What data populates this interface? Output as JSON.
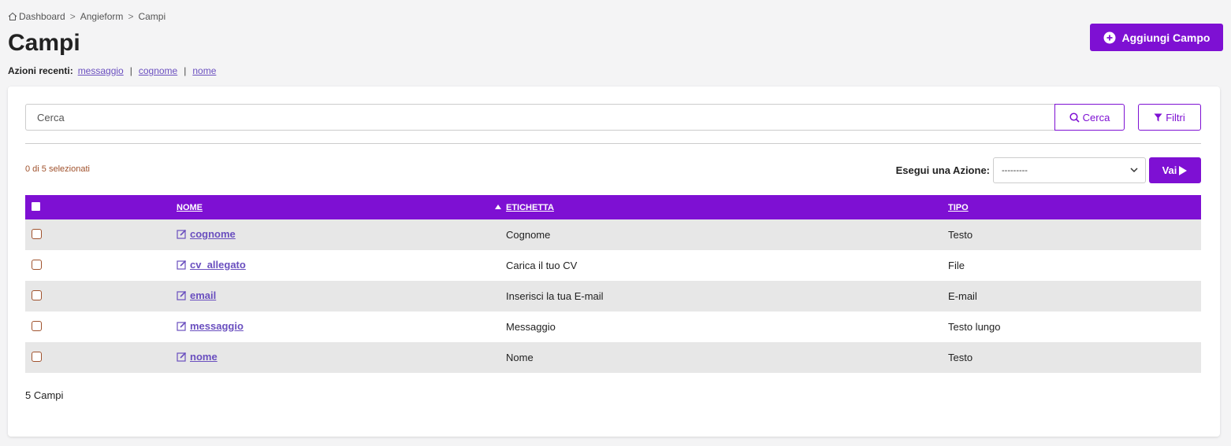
{
  "breadcrumb": {
    "items": [
      "Dashboard",
      "Angieform",
      "Campi"
    ],
    "separator": ">"
  },
  "page_title": "Campi",
  "recent_actions": {
    "label": "Azioni recenti",
    "items": [
      "messaggio",
      "cognome",
      "nome"
    ]
  },
  "add_button_label": "Aggiungi Campo",
  "search": {
    "placeholder": "Cerca",
    "button_label": "Cerca",
    "filter_label": "Filtri"
  },
  "selected_count": "0 di 5 selezionati",
  "action": {
    "label": "Esegui una Azione:",
    "selected_option": "---------",
    "go_label": "Vai"
  },
  "table": {
    "headers": [
      "NOME",
      "ETICHETTA",
      "TIPO"
    ],
    "rows": [
      {
        "nome": "cognome",
        "etichetta": "Cognome",
        "tipo": "Testo"
      },
      {
        "nome": "cv_allegato",
        "etichetta": "Carica il tuo CV",
        "tipo": "File"
      },
      {
        "nome": "email",
        "etichetta": "Inserisci la tua E-mail",
        "tipo": "E-mail"
      },
      {
        "nome": "messaggio",
        "etichetta": "Messaggio",
        "tipo": "Testo lungo"
      },
      {
        "nome": "nome",
        "etichetta": "Nome",
        "tipo": "Testo"
      }
    ]
  },
  "footer_count": "5 Campi",
  "colors": {
    "accent": "#7e10d3",
    "link": "#6a4fbf",
    "row_alt": "#e7e7e7"
  },
  "icons": {
    "home": "home-icon",
    "add": "plus-circle-icon",
    "search": "search-icon",
    "filter": "filter-icon",
    "edit": "edit-icon",
    "sort": "sort-asc-icon",
    "dropdown": "chevron-down-icon",
    "go": "play-icon"
  }
}
